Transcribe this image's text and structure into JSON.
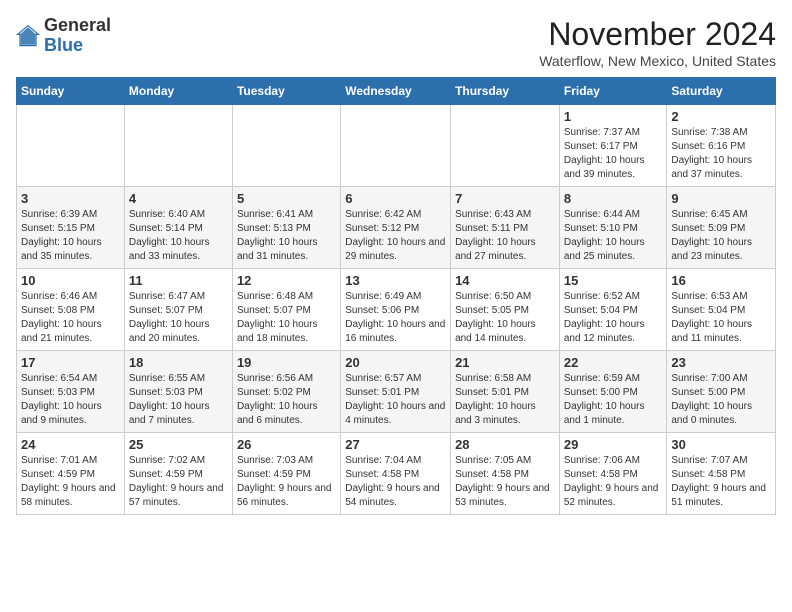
{
  "header": {
    "logo_general": "General",
    "logo_blue": "Blue",
    "month_title": "November 2024",
    "subtitle": "Waterflow, New Mexico, United States"
  },
  "weekdays": [
    "Sunday",
    "Monday",
    "Tuesday",
    "Wednesday",
    "Thursday",
    "Friday",
    "Saturday"
  ],
  "weeks": [
    [
      {
        "day": "",
        "info": ""
      },
      {
        "day": "",
        "info": ""
      },
      {
        "day": "",
        "info": ""
      },
      {
        "day": "",
        "info": ""
      },
      {
        "day": "",
        "info": ""
      },
      {
        "day": "1",
        "info": "Sunrise: 7:37 AM\nSunset: 6:17 PM\nDaylight: 10 hours and 39 minutes."
      },
      {
        "day": "2",
        "info": "Sunrise: 7:38 AM\nSunset: 6:16 PM\nDaylight: 10 hours and 37 minutes."
      }
    ],
    [
      {
        "day": "3",
        "info": "Sunrise: 6:39 AM\nSunset: 5:15 PM\nDaylight: 10 hours and 35 minutes."
      },
      {
        "day": "4",
        "info": "Sunrise: 6:40 AM\nSunset: 5:14 PM\nDaylight: 10 hours and 33 minutes."
      },
      {
        "day": "5",
        "info": "Sunrise: 6:41 AM\nSunset: 5:13 PM\nDaylight: 10 hours and 31 minutes."
      },
      {
        "day": "6",
        "info": "Sunrise: 6:42 AM\nSunset: 5:12 PM\nDaylight: 10 hours and 29 minutes."
      },
      {
        "day": "7",
        "info": "Sunrise: 6:43 AM\nSunset: 5:11 PM\nDaylight: 10 hours and 27 minutes."
      },
      {
        "day": "8",
        "info": "Sunrise: 6:44 AM\nSunset: 5:10 PM\nDaylight: 10 hours and 25 minutes."
      },
      {
        "day": "9",
        "info": "Sunrise: 6:45 AM\nSunset: 5:09 PM\nDaylight: 10 hours and 23 minutes."
      }
    ],
    [
      {
        "day": "10",
        "info": "Sunrise: 6:46 AM\nSunset: 5:08 PM\nDaylight: 10 hours and 21 minutes."
      },
      {
        "day": "11",
        "info": "Sunrise: 6:47 AM\nSunset: 5:07 PM\nDaylight: 10 hours and 20 minutes."
      },
      {
        "day": "12",
        "info": "Sunrise: 6:48 AM\nSunset: 5:07 PM\nDaylight: 10 hours and 18 minutes."
      },
      {
        "day": "13",
        "info": "Sunrise: 6:49 AM\nSunset: 5:06 PM\nDaylight: 10 hours and 16 minutes."
      },
      {
        "day": "14",
        "info": "Sunrise: 6:50 AM\nSunset: 5:05 PM\nDaylight: 10 hours and 14 minutes."
      },
      {
        "day": "15",
        "info": "Sunrise: 6:52 AM\nSunset: 5:04 PM\nDaylight: 10 hours and 12 minutes."
      },
      {
        "day": "16",
        "info": "Sunrise: 6:53 AM\nSunset: 5:04 PM\nDaylight: 10 hours and 11 minutes."
      }
    ],
    [
      {
        "day": "17",
        "info": "Sunrise: 6:54 AM\nSunset: 5:03 PM\nDaylight: 10 hours and 9 minutes."
      },
      {
        "day": "18",
        "info": "Sunrise: 6:55 AM\nSunset: 5:03 PM\nDaylight: 10 hours and 7 minutes."
      },
      {
        "day": "19",
        "info": "Sunrise: 6:56 AM\nSunset: 5:02 PM\nDaylight: 10 hours and 6 minutes."
      },
      {
        "day": "20",
        "info": "Sunrise: 6:57 AM\nSunset: 5:01 PM\nDaylight: 10 hours and 4 minutes."
      },
      {
        "day": "21",
        "info": "Sunrise: 6:58 AM\nSunset: 5:01 PM\nDaylight: 10 hours and 3 minutes."
      },
      {
        "day": "22",
        "info": "Sunrise: 6:59 AM\nSunset: 5:00 PM\nDaylight: 10 hours and 1 minute."
      },
      {
        "day": "23",
        "info": "Sunrise: 7:00 AM\nSunset: 5:00 PM\nDaylight: 10 hours and 0 minutes."
      }
    ],
    [
      {
        "day": "24",
        "info": "Sunrise: 7:01 AM\nSunset: 4:59 PM\nDaylight: 9 hours and 58 minutes."
      },
      {
        "day": "25",
        "info": "Sunrise: 7:02 AM\nSunset: 4:59 PM\nDaylight: 9 hours and 57 minutes."
      },
      {
        "day": "26",
        "info": "Sunrise: 7:03 AM\nSunset: 4:59 PM\nDaylight: 9 hours and 56 minutes."
      },
      {
        "day": "27",
        "info": "Sunrise: 7:04 AM\nSunset: 4:58 PM\nDaylight: 9 hours and 54 minutes."
      },
      {
        "day": "28",
        "info": "Sunrise: 7:05 AM\nSunset: 4:58 PM\nDaylight: 9 hours and 53 minutes."
      },
      {
        "day": "29",
        "info": "Sunrise: 7:06 AM\nSunset: 4:58 PM\nDaylight: 9 hours and 52 minutes."
      },
      {
        "day": "30",
        "info": "Sunrise: 7:07 AM\nSunset: 4:58 PM\nDaylight: 9 hours and 51 minutes."
      }
    ]
  ]
}
